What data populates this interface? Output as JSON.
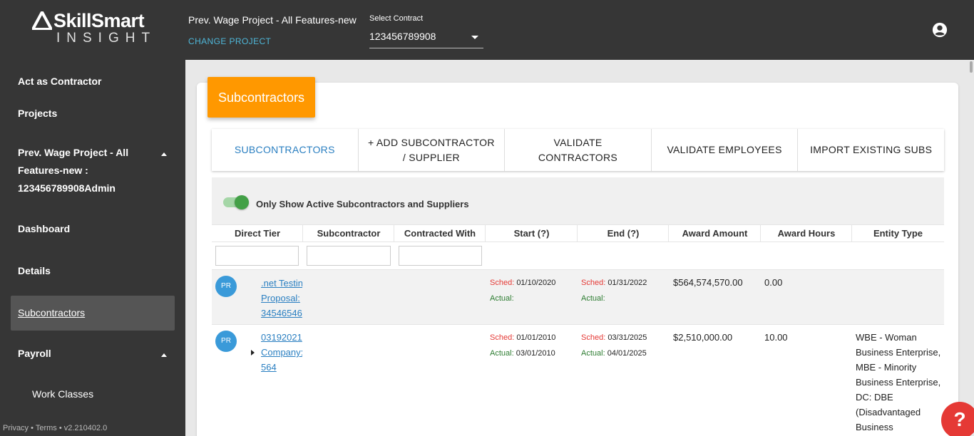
{
  "brand": {
    "line1": "SkillSmart",
    "line2": "INSIGHT"
  },
  "header": {
    "project_name": "Prev. Wage Project - All Features-new",
    "change_project": "CHANGE PROJECT",
    "contract_label": "Select Contract",
    "contract_value": "123456789908"
  },
  "sidebar": {
    "act_as_contractor": "Act as Contractor",
    "projects": "Projects",
    "project_line1": "Prev. Wage Project - All",
    "project_line2": "Features-new :",
    "project_line3": "123456789908Admin",
    "dashboard": "Dashboard",
    "details": "Details",
    "subcontractors": "Subcontractors",
    "payroll": "Payroll",
    "work_classes": "Work Classes",
    "footer": "Privacy • Terms • v2.210402.0"
  },
  "card": {
    "title": "Subcontractors"
  },
  "tabs": [
    {
      "label": "SUBCONTRACTORS"
    },
    {
      "label": "+ ADD SUBCONTRACTOR / SUPPLIER"
    },
    {
      "label": "VALIDATE CONTRACTORS"
    },
    {
      "label": "VALIDATE EMPLOYEES"
    },
    {
      "label": "IMPORT EXISTING SUBS"
    }
  ],
  "filter_toggle_label": "Only Show Active Subcontractors and Suppliers",
  "columns": [
    "Direct Tier",
    "Subcontractor",
    "Contracted With",
    "Start (?)",
    "End (?)",
    "Award Amount",
    "Award Hours",
    "Entity Type"
  ],
  "rows": [
    {
      "avatar": "PR",
      "direct_tier": [
        ".net Testin",
        "Proposal:",
        "34546546"
      ],
      "start_sched_label": "Sched:",
      "start_sched": "01/10/2020",
      "start_actual_label": "Actual:",
      "start_actual": "",
      "end_sched_label": "Sched:",
      "end_sched": "01/31/2022",
      "end_actual_label": "Actual:",
      "end_actual": "",
      "award_amount": "$564,574,570.00",
      "award_hours": "0.00",
      "entity_type": []
    },
    {
      "avatar": "PR",
      "direct_tier": [
        "03192021",
        "Company:",
        "564"
      ],
      "start_sched_label": "Sched:",
      "start_sched": "01/01/2010",
      "start_actual_label": "Actual:",
      "start_actual": "03/01/2010",
      "end_sched_label": "Sched:",
      "end_sched": "03/31/2025",
      "end_actual_label": "Actual:",
      "end_actual": "04/01/2025",
      "award_amount": "$2,510,000.00",
      "award_hours": "10.00",
      "entity_type": [
        "WBE - Woman",
        "Business Enterprise,",
        "MBE - Minority",
        "Business Enterprise,",
        "DC: DBE",
        "(Disadvantaged",
        "Business"
      ]
    }
  ],
  "help_label": "?",
  "colors": {
    "accent_orange": "#ff9800",
    "link_blue": "#2a7fc1",
    "toggle_green": "#43a047",
    "help_red": "#e53935"
  },
  "icons": {
    "account": "account-circle-icon",
    "logo": "skillsmart-logo-icon"
  }
}
